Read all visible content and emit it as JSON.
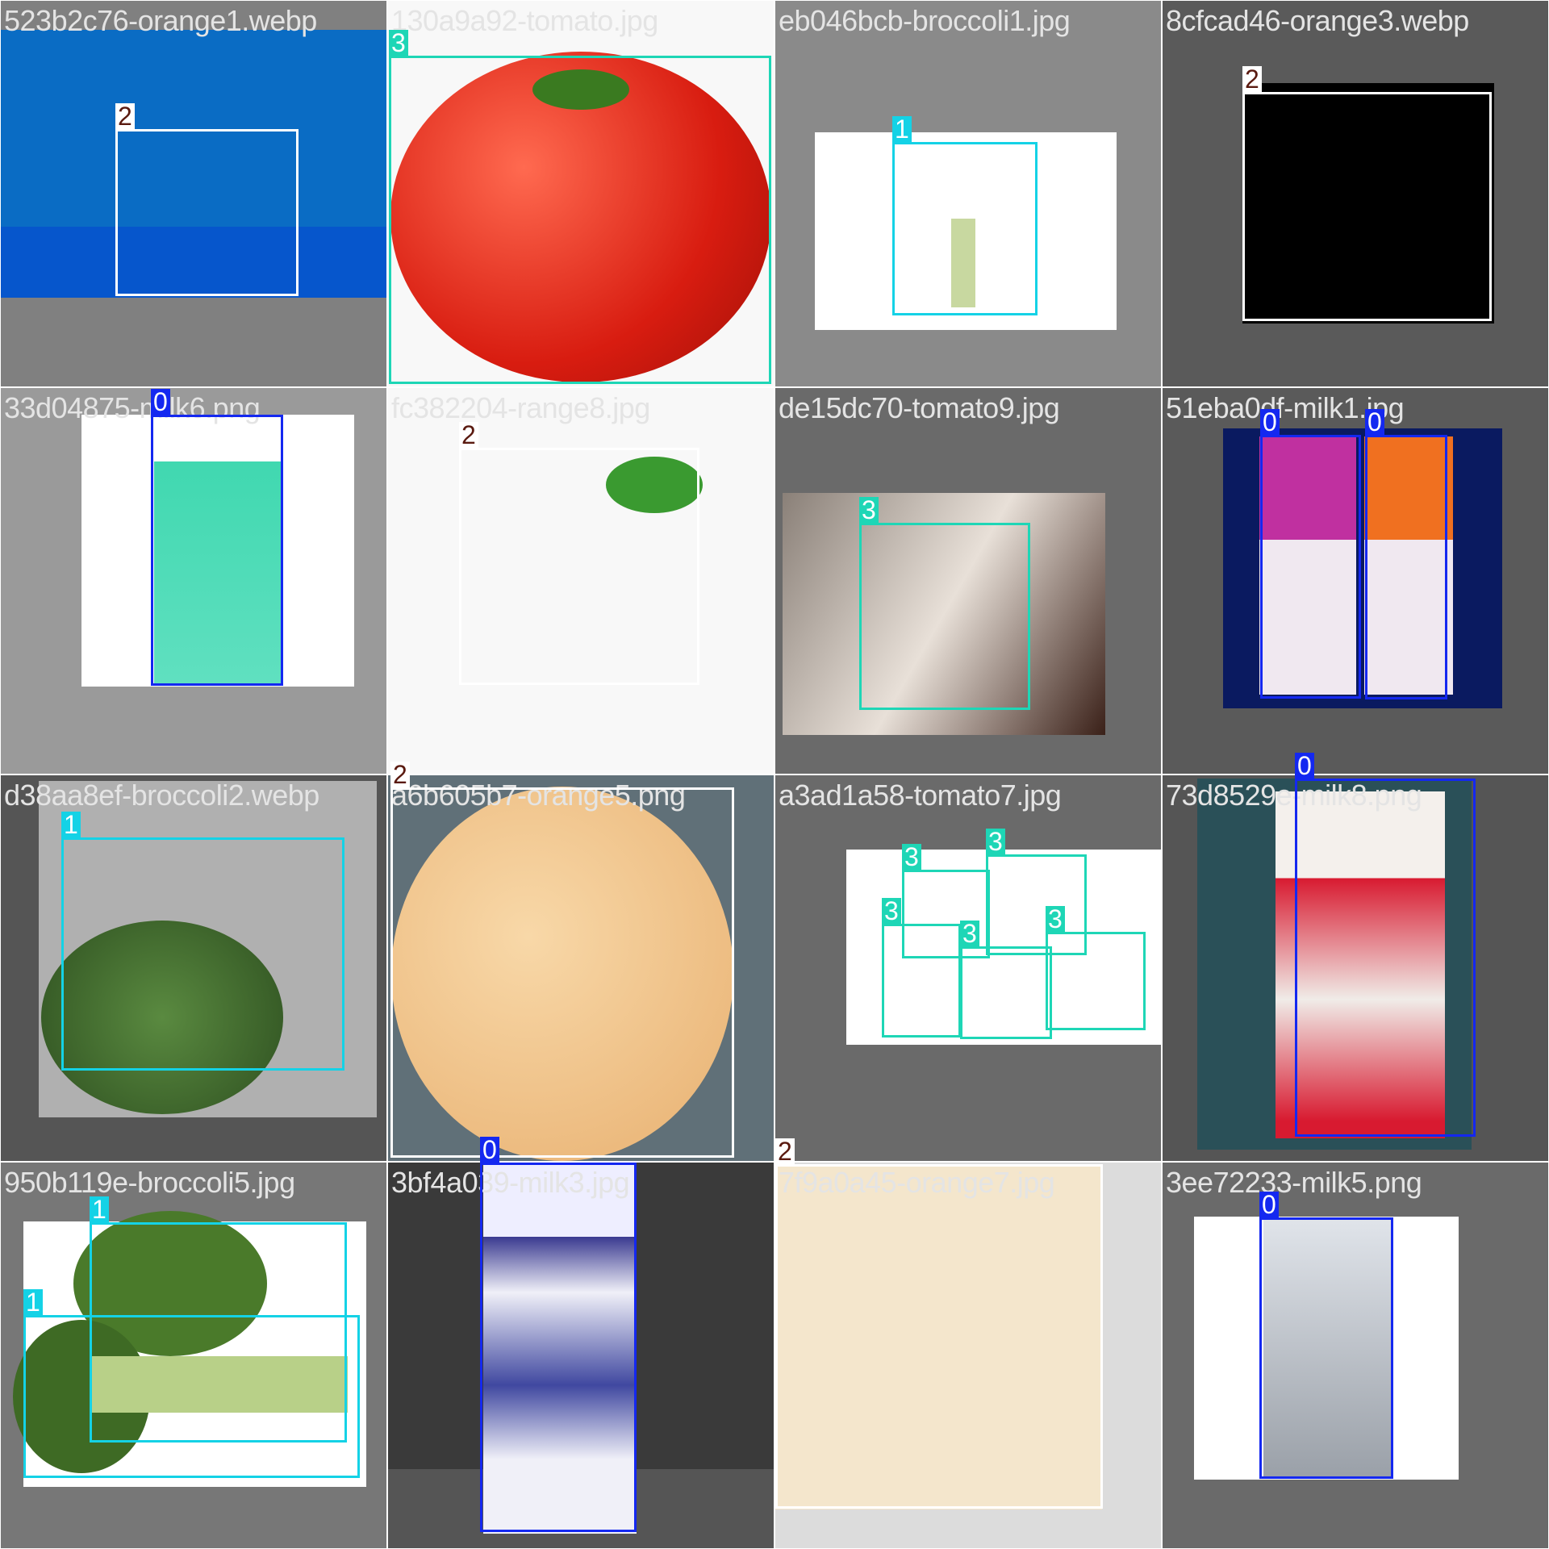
{
  "class_colors": {
    "0": "#1428f0",
    "1": "#14d2e6",
    "2": "#ffffff",
    "3": "#1ed6b6"
  },
  "class_text_colors": {
    "0": "#ffffff",
    "1": "#ffffff",
    "2": "#5a1a10",
    "3": "#ffffff"
  },
  "tiles": [
    {
      "filename": "523b2c76-orange1.webp",
      "labels": [
        "2"
      ]
    },
    {
      "filename": "130a9a92-tomato.jpg",
      "labels": [
        "3"
      ]
    },
    {
      "filename": "eb046bcb-broccoli1.jpg",
      "labels": [
        "1"
      ]
    },
    {
      "filename": "8cfcad46-orange3.webp",
      "labels": [
        "2"
      ]
    },
    {
      "filename": "33d04875-milk6.png",
      "labels": [
        "0"
      ]
    },
    {
      "filename": "fc382204-range8.jpg",
      "labels": [
        "2"
      ]
    },
    {
      "filename": "de15dc70-tomato9.jpg",
      "labels": [
        "3"
      ]
    },
    {
      "filename": "51eba0df-milk1.jpg",
      "labels": [
        "0",
        "0"
      ]
    },
    {
      "filename": "d38aa8ef-broccoli2.webp",
      "labels": [
        "1"
      ]
    },
    {
      "filename": "a6b605b7-orange5.png",
      "labels": [
        "2"
      ]
    },
    {
      "filename": "a3ad1a58-tomato7.jpg",
      "labels": [
        "3",
        "3",
        "3",
        "3",
        "3"
      ]
    },
    {
      "filename": "73d8529e-milk8.png",
      "labels": [
        "0"
      ]
    },
    {
      "filename": "950b119e-broccoli5.jpg",
      "labels": [
        "1",
        "1"
      ]
    },
    {
      "filename": "3bf4a039-milk3.jpg",
      "labels": [
        "0"
      ]
    },
    {
      "filename": "7f9a0a45-orange7.jpg",
      "labels": [
        "2"
      ]
    },
    {
      "filename": "3ee72233-milk5.png",
      "labels": [
        "0"
      ]
    }
  ]
}
